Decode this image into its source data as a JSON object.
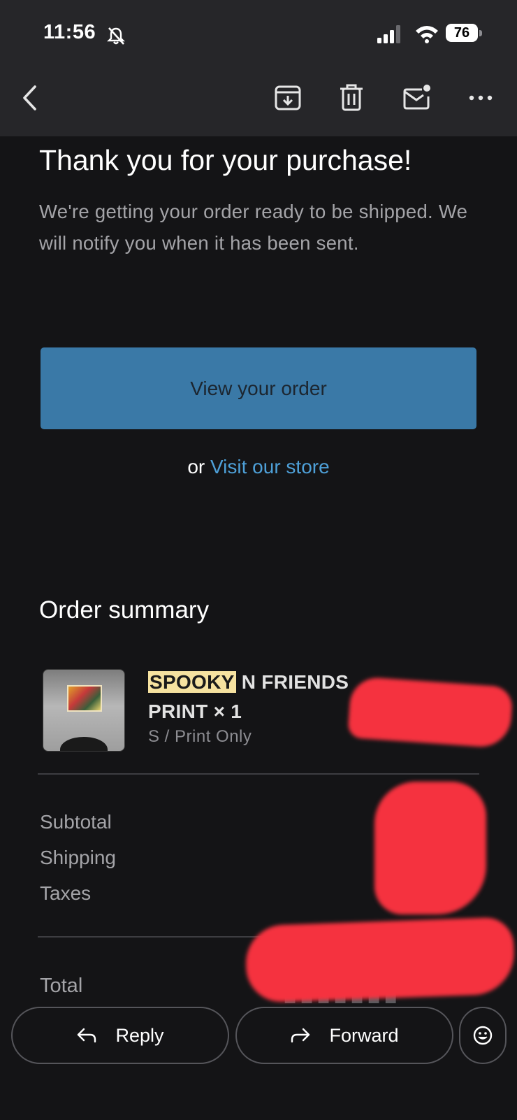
{
  "status_bar": {
    "time": "11:56",
    "battery": "76"
  },
  "toolbar": {
    "icons": [
      "back-arrow-icon",
      "archive-icon",
      "trash-icon",
      "mark-unread-icon",
      "more-icon"
    ]
  },
  "email": {
    "heading": "Thank you for your purchase!",
    "body": "We're getting your order ready to be shipped. We will notify you when it has been sent.",
    "view_order_label": "View your order",
    "or_text": "or",
    "visit_store_label": "Visit our store",
    "summary_title": "Order summary",
    "product": {
      "name_highlight": "SPOOKY",
      "name_rest": " N FRIENDS PRINT × 1",
      "variant": "S / Print Only"
    },
    "summary_rows": [
      "Subtotal",
      "Shipping",
      "Taxes"
    ],
    "total_label": "Total"
  },
  "actions": {
    "reply_label": "Reply",
    "forward_label": "Forward"
  },
  "colors": {
    "background": "#141416",
    "button": "#3a79a7",
    "link": "#4ea0d8",
    "redaction": "#f5323f"
  }
}
